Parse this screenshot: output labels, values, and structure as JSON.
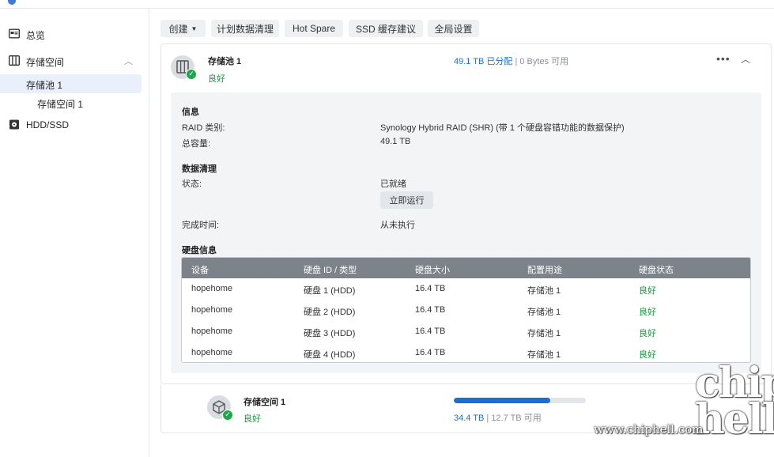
{
  "sidebar": {
    "items": [
      {
        "label": "总览"
      },
      {
        "label": "存储空间"
      },
      {
        "label": "存储池 1"
      },
      {
        "label": "存储空间 1"
      },
      {
        "label": "HDD/SSD"
      }
    ]
  },
  "toolbar": {
    "create_label": "创建",
    "scrub_label": "计划数据清理",
    "hotspare_label": "Hot Spare",
    "ssd_cache_label": "SSD 缓存建议",
    "global_settings_label": "全局设置"
  },
  "pool": {
    "name": "存储池 1",
    "status": "良好",
    "allocated": "49.1 TB 已分配",
    "separator": " | ",
    "available": "0 Bytes 可用",
    "info": {
      "heading": "信息",
      "raid_key": "RAID 类别:",
      "raid_value": "Synology Hybrid RAID (SHR) (带 1 个硬盘容错功能的数据保护)",
      "capacity_key": "总容量:",
      "capacity_value": "49.1 TB"
    },
    "scrub": {
      "heading": "数据清理",
      "status_key": "状态:",
      "status_value": "已就绪",
      "run_now_label": "立即运行",
      "finish_key": "完成时间:",
      "finish_value": "从未执行"
    },
    "disks": {
      "heading": "硬盘信息",
      "columns": [
        "设备",
        "硬盘 ID / 类型",
        "硬盘大小",
        "配置用途",
        "硬盘状态"
      ],
      "rows": [
        [
          "hopehome",
          "硬盘 1 (HDD)",
          "16.4 TB",
          "存储池 1",
          "良好"
        ],
        [
          "hopehome",
          "硬盘 2 (HDD)",
          "16.4 TB",
          "存储池 1",
          "良好"
        ],
        [
          "hopehome",
          "硬盘 3 (HDD)",
          "16.4 TB",
          "存储池 1",
          "良好"
        ],
        [
          "hopehome",
          "硬盘 4 (HDD)",
          "16.4 TB",
          "存储池 1",
          "良好"
        ]
      ]
    }
  },
  "volume": {
    "name": "存储空间 1",
    "status": "良好",
    "used": "34.4 TB",
    "separator": " | ",
    "available": "12.7 TB 可用",
    "usage_fraction": 0.73
  },
  "watermark": {
    "url": "www.chiphell.com",
    "logo": "chip hell"
  },
  "colors": {
    "accent": "#1a6fd6",
    "good": "#1a9a3d",
    "table_header": "#7d838a"
  }
}
